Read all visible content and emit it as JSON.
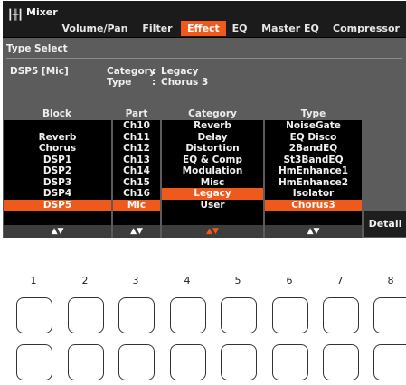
{
  "header": {
    "icon": "mixer-sliders-icon",
    "title": "Mixer",
    "tabs": [
      {
        "label": "Volume/Pan",
        "active": false
      },
      {
        "label": "Filter",
        "active": false
      },
      {
        "label": "Effect",
        "active": true
      },
      {
        "label": "EQ",
        "active": false
      },
      {
        "label": "Master EQ",
        "active": false
      },
      {
        "label": "Compressor",
        "active": false
      }
    ]
  },
  "panel": {
    "title": "Type Select",
    "current_part": "DSP5 [Mic]",
    "category_label": "Category",
    "category_value": "Legacy",
    "type_label": "Type",
    "type_value": "Chorus 3"
  },
  "columns": {
    "block": {
      "header": "Block",
      "items": [
        "",
        "Reverb",
        "Chorus",
        "DSP1",
        "DSP2",
        "DSP3",
        "DSP4",
        "DSP5"
      ],
      "selected": "DSP5",
      "arrow": "▲▼"
    },
    "part": {
      "header": "Part",
      "items": [
        "Ch10",
        "Ch11",
        "Ch12",
        "Ch13",
        "Ch14",
        "Ch15",
        "Ch16",
        "Mic"
      ],
      "selected": "Mic",
      "arrow": "▲▼"
    },
    "category": {
      "header": "Category",
      "items": [
        "Reverb",
        "Delay",
        "Distortion",
        "EQ & Comp",
        "Modulation",
        "Misc",
        "Legacy",
        "User"
      ],
      "selected": "Legacy",
      "arrow": "▲▼"
    },
    "type": {
      "header": "Type",
      "items": [
        "NoiseGate",
        "EQ Disco",
        "2BandEQ",
        "St3BandEQ",
        "HmEnhance1",
        "HmEnhance2",
        "Isolator",
        "Chorus3"
      ],
      "selected": "Chorus3",
      "arrow": "▲▼"
    }
  },
  "detail_button": "Detail",
  "physical_buttons": {
    "numbers": [
      "1",
      "2",
      "3",
      "4",
      "5",
      "6",
      "7",
      "8"
    ]
  },
  "colors": {
    "accent": "#ef5a1c",
    "panel_bg": "#5c5c5c",
    "screen_bg": "#000000"
  }
}
